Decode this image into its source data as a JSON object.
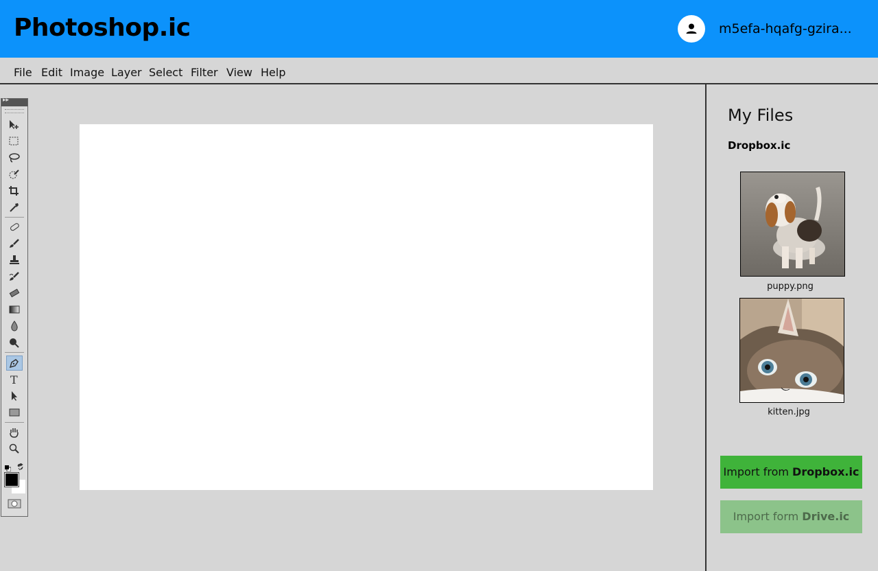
{
  "app": {
    "title": "Photoshop.ic",
    "username": "m5efa-hqafg-gzira..."
  },
  "menu": [
    "File",
    "Edit",
    "Image",
    "Layer",
    "Select",
    "Filter",
    "View",
    "Help"
  ],
  "toolbox": {
    "active_tool": "pen-tool",
    "foreground_color": "#000000",
    "background_color": "#ffffff"
  },
  "files": {
    "title": "My Files",
    "source": "Dropbox.ic",
    "items": [
      {
        "name": "puppy.png"
      },
      {
        "name": "kitten.jpg"
      }
    ]
  },
  "buttons": {
    "import_dropbox_prefix": "Import from ",
    "import_dropbox_service": "Dropbox.ic",
    "import_drive_prefix": "Import form ",
    "import_drive_service": "Drive.ic"
  },
  "colors": {
    "header": "#0c92fb",
    "primary_button": "#3fb33a",
    "disabled_button": "#8cc38a"
  }
}
